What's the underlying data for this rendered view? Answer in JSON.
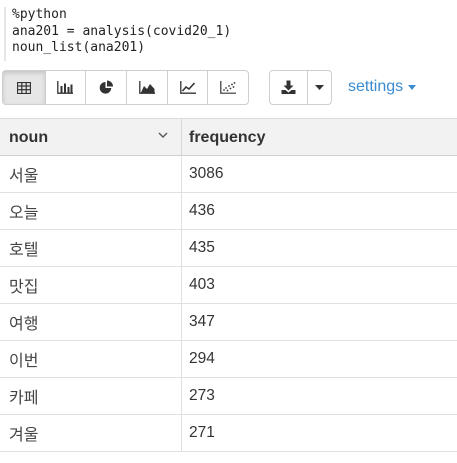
{
  "code": {
    "lines": [
      "%python",
      "ana201 = analysis(covid20_1)",
      "noun_list(ana201)"
    ]
  },
  "toolbar": {
    "view_buttons": [
      {
        "icon": "table-icon",
        "active": true
      },
      {
        "icon": "bar-chart-icon",
        "active": false
      },
      {
        "icon": "pie-chart-icon",
        "active": false
      },
      {
        "icon": "area-chart-icon",
        "active": false
      },
      {
        "icon": "line-chart-icon",
        "active": false
      },
      {
        "icon": "scatter-chart-icon",
        "active": false
      }
    ],
    "download_icon": "download-icon",
    "dropdown_icon": "caret-down-icon",
    "settings_label": "settings"
  },
  "table": {
    "columns": [
      "noun",
      "frequency"
    ],
    "rows": [
      {
        "noun": "서울",
        "frequency": "3086"
      },
      {
        "noun": "오늘",
        "frequency": "436"
      },
      {
        "noun": "호텔",
        "frequency": "435"
      },
      {
        "noun": "맛집",
        "frequency": "403"
      },
      {
        "noun": "여행",
        "frequency": "347"
      },
      {
        "noun": "이번",
        "frequency": "294"
      },
      {
        "noun": "카페",
        "frequency": "273"
      },
      {
        "noun": "겨울",
        "frequency": "271"
      }
    ]
  },
  "colors": {
    "accent": "#3a8bd0",
    "header_bg": "#f2f2f2",
    "active_btn_bg": "#e6e6e6"
  }
}
